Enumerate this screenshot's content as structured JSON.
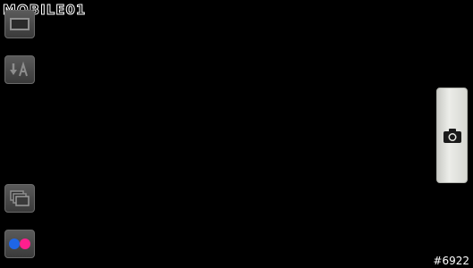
{
  "watermark": {
    "logo_text": "MOBILE01",
    "id_text": "#6922"
  },
  "left_controls": [
    {
      "name": "viewfinder-mode-button",
      "icon": "frame-icon"
    },
    {
      "name": "scene-mode-button",
      "icon": "scene-auto-icon"
    },
    {
      "name": "gallery-button",
      "icon": "gallery-stack-icon"
    },
    {
      "name": "flickr-upload-button",
      "icon": "flickr-icon"
    }
  ],
  "shutter": {
    "icon": "camera-icon"
  },
  "colors": {
    "background": "#000000",
    "button_gray": "#4a4a4a",
    "shutter_panel": "#e6e7e2",
    "flickr_blue": "#1e66e6",
    "flickr_pink": "#ff1f8e"
  }
}
